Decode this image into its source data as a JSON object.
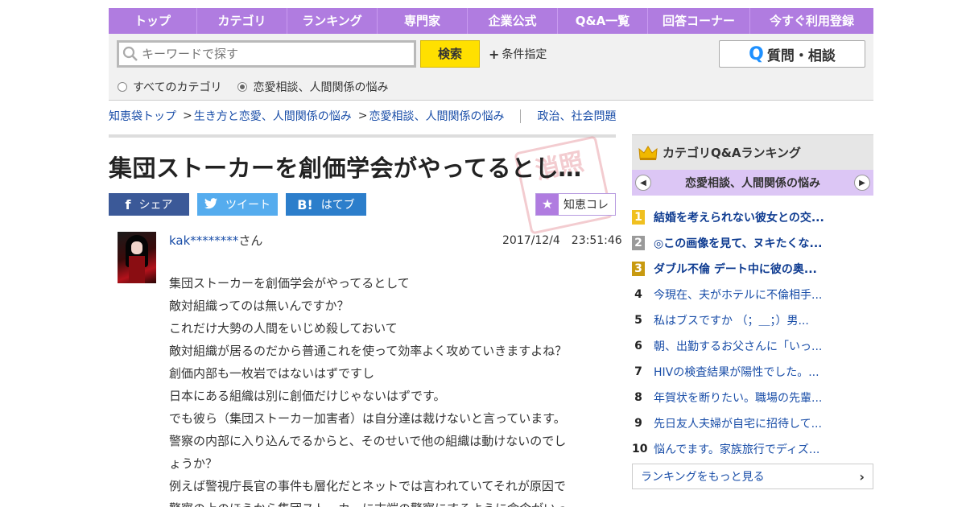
{
  "nav": [
    "トップ",
    "カテゴリ",
    "ランキング",
    "専門家",
    "企業公式",
    "Q&A一覧",
    "回答コーナー",
    "今すぐ利用登録"
  ],
  "search": {
    "placeholder": "キーワードで探す",
    "button": "検索",
    "conditions": "条件指定",
    "ask_button": "質問・相談",
    "radio_all": "すべてのカテゴリ",
    "radio_current": "恋愛相談、人間関係の悩み"
  },
  "breadcrumb": {
    "top": "知恵袋トップ",
    "level1": "生き方と恋愛、人間関係の悩み",
    "level2": "恋愛相談、人間関係の悩み",
    "other": "政治、社会問題"
  },
  "question": {
    "title": "集団ストーカーを創価学会がやってるとして ...",
    "stamp": "消照",
    "author_id": "kak********",
    "author_suffix": "さん",
    "datetime": "2017/12/4　23:51:46",
    "lines": [
      "集団ストーカーを創価学会がやってるとして",
      "敵対組織ってのは無いんですか？",
      "これだけ大勢の人間をいじめ殺しておいて",
      "敵対組織が居るのだから普通これを使って効率よく攻めていきますよね？",
      "創価内部も一枚岩ではないはずですし",
      "日本にある組織は別に創価だけじゃないはずです。",
      "でも彼ら（集団ストーカー加害者）は自分達は裁けないと言っています。",
      "警察の内部に入り込んでるからと、そのせいで他の組織は動けないのでし",
      "ょうか？",
      "例えば警視庁長官の事件も層化だとネットでは言われていてそれが原因で",
      "警察の上のほうから集団ストーカーに末端の警察にするように命令がいっ"
    ]
  },
  "share": {
    "facebook": "シェア",
    "twitter": "ツイート",
    "hatena": "はてブ",
    "chie_collection": "知恵コレ"
  },
  "sidebar": {
    "heading": "カテゴリQ&Aランキング",
    "category": "恋愛相談、人間関係の悩み",
    "more": "ランキングをもっと見る",
    "ranking": [
      {
        "rank": "1",
        "title": "結婚を考えられない彼女との交..."
      },
      {
        "rank": "2",
        "title": "◎この画像を見て、ヌキたくな..."
      },
      {
        "rank": "3",
        "title": "ダブル不倫 デート中に彼の奥..."
      },
      {
        "rank": "4",
        "title": "今現在、夫がホテルに不倫相手..."
      },
      {
        "rank": "5",
        "title": "私はブスですか （；＿；）男..."
      },
      {
        "rank": "6",
        "title": "朝、出勤するお父さんに「いっ..."
      },
      {
        "rank": "7",
        "title": "HIVの検査結果が陽性でした。..."
      },
      {
        "rank": "8",
        "title": "年賀状を断りたい。職場の先輩..."
      },
      {
        "rank": "9",
        "title": "先日友人夫婦が自宅に招待して..."
      },
      {
        "rank": "10",
        "title": "悩んでます。家族旅行でディズ..."
      }
    ]
  },
  "colors": {
    "nav_purple": "#b07ce0",
    "category_band": "#dcc6f5",
    "search_button": "#ffe000",
    "link": "#1a4ea8"
  },
  "icons": [
    "search-icon",
    "plus-icon",
    "q-icon",
    "facebook-icon",
    "twitter-icon",
    "hatena-icon",
    "star-icon",
    "crown-icon",
    "chevron-left-icon",
    "chevron-right-icon"
  ]
}
